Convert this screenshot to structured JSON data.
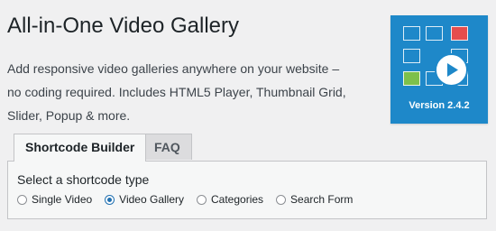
{
  "header": {
    "title": "All-in-One Video Gallery",
    "intro_line1": "Add responsive video galleries anywhere on your website –",
    "intro_line2": "no coding required. Includes HTML5 Player, Thumbnail Grid,",
    "intro_line3": "Slider, Popup & more."
  },
  "logo": {
    "version": "Version 2.4.2",
    "background_color": "#1e88c9",
    "accent_red": "#e64d4d",
    "accent_green": "#7dc04b",
    "icon": "play-icon"
  },
  "tabs": [
    {
      "label": "Shortcode Builder",
      "active": true
    },
    {
      "label": "FAQ",
      "active": false
    }
  ],
  "builder": {
    "title": "Select a shortcode type",
    "options": [
      {
        "label": "Single Video",
        "checked": false
      },
      {
        "label": "Video Gallery",
        "checked": true
      },
      {
        "label": "Categories",
        "checked": false
      },
      {
        "label": "Search Form",
        "checked": false
      }
    ]
  }
}
